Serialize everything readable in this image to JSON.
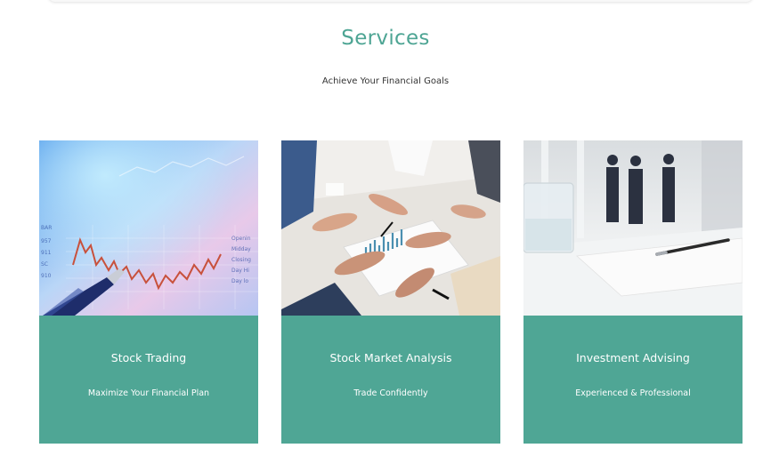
{
  "section": {
    "title": "Services",
    "subtitle": "Achieve Your Financial Goals"
  },
  "cards": [
    {
      "title": "Stock Trading",
      "subtitle": "Maximize Your Financial Plan",
      "image_icon": "stock-chart-pen-photo"
    },
    {
      "title": "Stock Market Analysis",
      "subtitle": "Trade Confidently",
      "image_icon": "team-reviewing-charts-photo"
    },
    {
      "title": "Investment Advising",
      "subtitle": "Experienced & Professional",
      "image_icon": "office-meeting-room-photo"
    }
  ],
  "colors": {
    "accent": "#4ea594",
    "card_panel": "#4fa695"
  }
}
